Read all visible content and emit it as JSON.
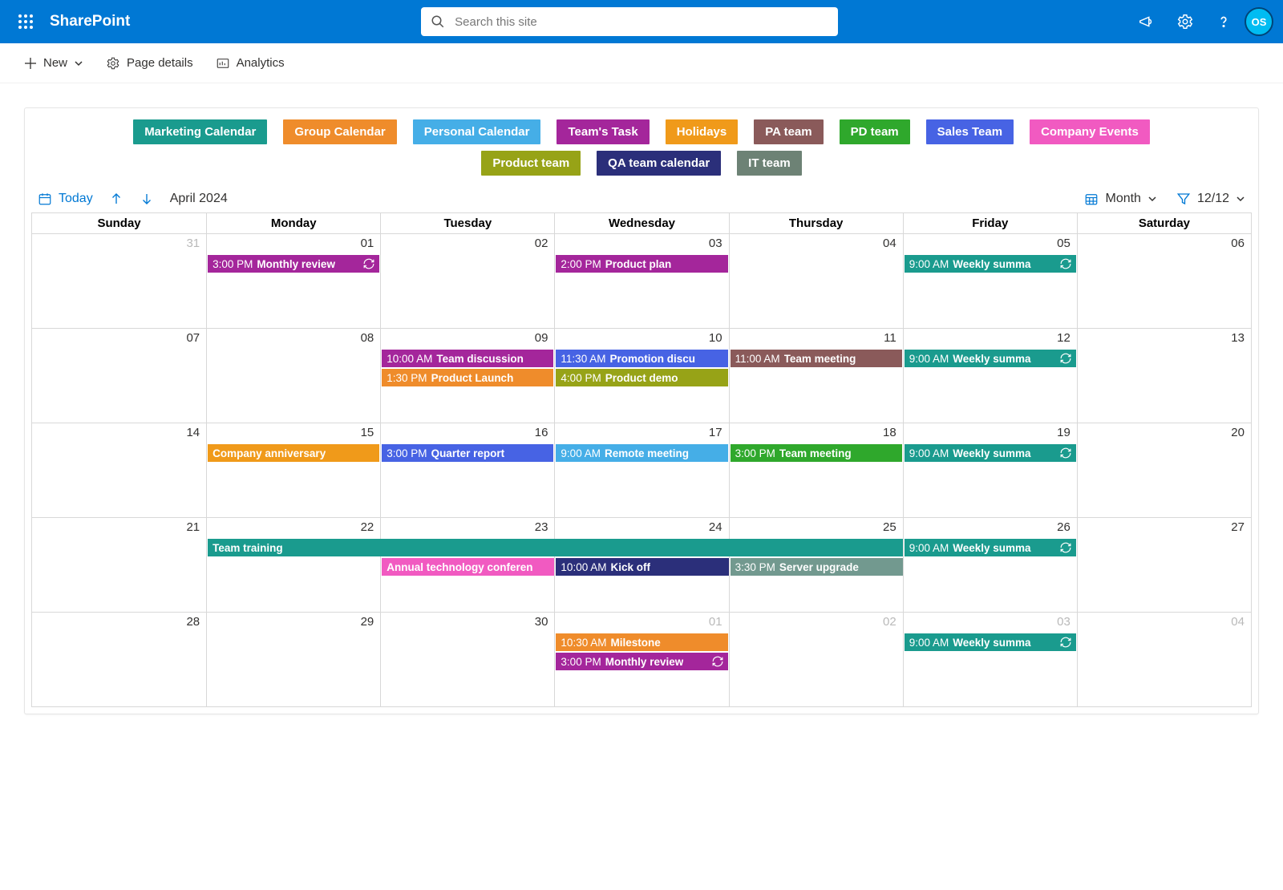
{
  "app": {
    "name": "SharePoint"
  },
  "search": {
    "placeholder": "Search this site"
  },
  "cmdbar": {
    "new": "New",
    "pageDetails": "Page details",
    "analytics": "Analytics"
  },
  "chips": [
    {
      "label": "Marketing Calendar",
      "color": "c-teal"
    },
    {
      "label": "Group Calendar",
      "color": "c-orange"
    },
    {
      "label": "Personal Calendar",
      "color": "c-ltblue"
    },
    {
      "label": "Team's Task",
      "color": "c-purple"
    },
    {
      "label": "Holidays",
      "color": "c-amber"
    },
    {
      "label": "PA team",
      "color": "c-brown"
    },
    {
      "label": "PD team",
      "color": "c-green"
    },
    {
      "label": "Sales Team",
      "color": "c-blue"
    },
    {
      "label": "Company Events",
      "color": "c-pink"
    },
    {
      "label": "Product team",
      "color": "c-olive"
    },
    {
      "label": "QA team calendar",
      "color": "c-navy"
    },
    {
      "label": "IT team",
      "color": "c-slate"
    }
  ],
  "toolbar": {
    "today": "Today",
    "heading": "April 2024",
    "view": "Month",
    "filter": "12/12"
  },
  "dow": [
    "Sunday",
    "Monday",
    "Tuesday",
    "Wednesday",
    "Thursday",
    "Friday",
    "Saturday"
  ],
  "weeks": [
    {
      "days": [
        {
          "num": "31",
          "faded": true,
          "events": []
        },
        {
          "num": "01",
          "events": [
            {
              "time": "3:00 PM",
              "name": "Monthly review",
              "color": "c-purple",
              "recur": true
            }
          ]
        },
        {
          "num": "02",
          "events": []
        },
        {
          "num": "03",
          "events": [
            {
              "time": "2:00 PM",
              "name": "Product plan",
              "color": "c-purple"
            }
          ]
        },
        {
          "num": "04",
          "events": []
        },
        {
          "num": "05",
          "events": [
            {
              "time": "9:00 AM",
              "name": "Weekly summa",
              "color": "c-teal",
              "recur": true
            }
          ]
        },
        {
          "num": "06",
          "events": []
        }
      ]
    },
    {
      "days": [
        {
          "num": "07",
          "events": []
        },
        {
          "num": "08",
          "events": []
        },
        {
          "num": "09",
          "events": [
            {
              "time": "10:00 AM",
              "name": "Team discussion",
              "color": "c-purple"
            },
            {
              "time": "1:30 PM",
              "name": "Product Launch",
              "color": "c-orange"
            }
          ]
        },
        {
          "num": "10",
          "events": [
            {
              "time": "11:30 AM",
              "name": "Promotion discu",
              "color": "c-blue"
            },
            {
              "time": "4:00 PM",
              "name": "Product demo",
              "color": "c-olive"
            }
          ]
        },
        {
          "num": "11",
          "events": [
            {
              "time": "11:00 AM",
              "name": "Team meeting",
              "color": "c-brown"
            }
          ]
        },
        {
          "num": "12",
          "events": [
            {
              "time": "9:00 AM",
              "name": "Weekly summa",
              "color": "c-teal",
              "recur": true
            }
          ]
        },
        {
          "num": "13",
          "events": []
        }
      ]
    },
    {
      "days": [
        {
          "num": "14",
          "events": []
        },
        {
          "num": "15",
          "events": [
            {
              "time": "",
              "name": "Company anniversary",
              "color": "c-amber"
            }
          ]
        },
        {
          "num": "16",
          "events": [
            {
              "time": "3:00 PM",
              "name": "Quarter report",
              "color": "c-blue"
            }
          ]
        },
        {
          "num": "17",
          "events": [
            {
              "time": "9:00 AM",
              "name": "Remote meeting",
              "color": "c-ltblue"
            }
          ]
        },
        {
          "num": "18",
          "events": [
            {
              "time": "3:00 PM",
              "name": "Team meeting",
              "color": "c-green"
            }
          ]
        },
        {
          "num": "19",
          "events": [
            {
              "time": "9:00 AM",
              "name": "Weekly summa",
              "color": "c-teal",
              "recur": true
            }
          ]
        },
        {
          "num": "20",
          "events": []
        }
      ]
    },
    {
      "days": [
        {
          "num": "21",
          "events": []
        },
        {
          "num": "22",
          "events": []
        },
        {
          "num": "23",
          "events": []
        },
        {
          "num": "24",
          "events": []
        },
        {
          "num": "25",
          "events": []
        },
        {
          "num": "26",
          "events": [
            {
              "time": "9:00 AM",
              "name": "Weekly summa",
              "color": "c-teal",
              "recur": true
            }
          ]
        },
        {
          "num": "27",
          "events": []
        }
      ],
      "spans": [
        {
          "name": "Team training",
          "color": "c-teal",
          "from": 1,
          "to": 5,
          "row": 0
        },
        {
          "name": "Annual technology conferen",
          "color": "c-pink",
          "from": 2,
          "to": 3,
          "row": 1
        },
        {
          "time": "10:00 AM",
          "name": "Kick off",
          "color": "c-navy",
          "from": 3,
          "to": 4,
          "row": 1
        },
        {
          "time": "3:30 PM",
          "name": "Server upgrade",
          "color": "c-steel",
          "from": 4,
          "to": 5,
          "row": 1
        }
      ]
    },
    {
      "days": [
        {
          "num": "28",
          "events": []
        },
        {
          "num": "29",
          "events": []
        },
        {
          "num": "30",
          "events": []
        },
        {
          "num": "01",
          "faded": true,
          "events": [
            {
              "time": "10:30 AM",
              "name": "Milestone",
              "color": "c-orange"
            },
            {
              "time": "3:00 PM",
              "name": "Monthly review",
              "color": "c-purple",
              "recur": true
            }
          ]
        },
        {
          "num": "02",
          "faded": true,
          "events": []
        },
        {
          "num": "03",
          "faded": true,
          "events": [
            {
              "time": "9:00 AM",
              "name": "Weekly summa",
              "color": "c-teal",
              "recur": true
            }
          ]
        },
        {
          "num": "04",
          "faded": true,
          "events": []
        }
      ]
    }
  ]
}
